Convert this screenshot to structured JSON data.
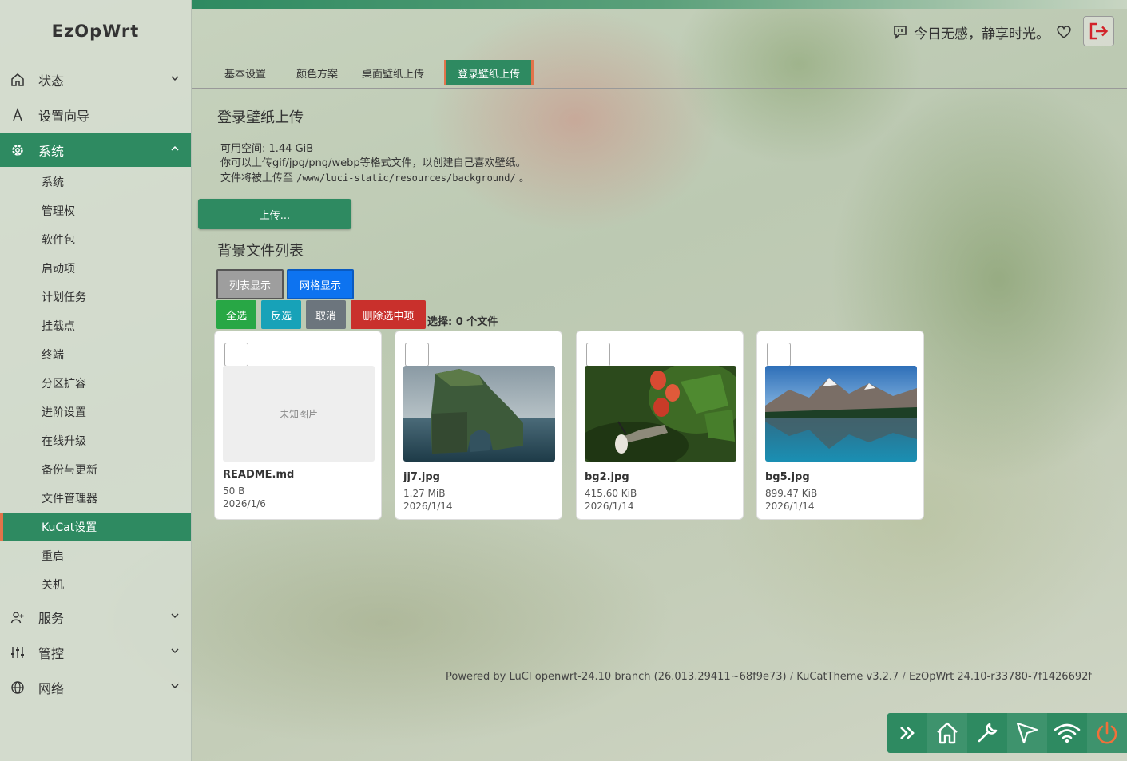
{
  "app": {
    "brand": "EzOpWrt"
  },
  "colors": {
    "accent": "#2e8a61",
    "accent_edge": "#e2734a",
    "danger": "#c9302c",
    "primary": "#0d73f0",
    "success": "#28a745",
    "info": "#17a2b8",
    "secondary": "#6c757d"
  },
  "sidebar": {
    "items": [
      {
        "label": "状态",
        "icon": "home-icon"
      },
      {
        "label": "设置向导",
        "icon": "wizard-icon"
      },
      {
        "label": "系统",
        "icon": "gear-icon"
      },
      {
        "label": "服务",
        "icon": "user-plus-icon"
      },
      {
        "label": "管控",
        "icon": "sliders-icon"
      },
      {
        "label": "网络",
        "icon": "globe-icon"
      }
    ],
    "system_sub": [
      {
        "label": "系统"
      },
      {
        "label": "管理权"
      },
      {
        "label": "软件包"
      },
      {
        "label": "启动项"
      },
      {
        "label": "计划任务"
      },
      {
        "label": "挂载点"
      },
      {
        "label": "终端"
      },
      {
        "label": "分区扩容"
      },
      {
        "label": "进阶设置"
      },
      {
        "label": "在线升级"
      },
      {
        "label": "备份与更新"
      },
      {
        "label": "文件管理器"
      },
      {
        "label": "KuCat设置"
      },
      {
        "label": "重启"
      },
      {
        "label": "关机"
      }
    ]
  },
  "header": {
    "motto": "今日无感，静享时光。"
  },
  "tabs": [
    {
      "label": "基本设置"
    },
    {
      "label": "颜色方案"
    },
    {
      "label": "桌面壁纸上传"
    },
    {
      "label": "登录壁纸上传"
    }
  ],
  "upload": {
    "title": "登录壁纸上传",
    "free_space": "可用空间: 1.44 GiB",
    "hint": "你可以上传gif/jpg/png/webp等格式文件，以创建自己喜欢壁纸。",
    "path_prefix": "文件将被上传至",
    "path": "/www/luci-static/resources/background/",
    "path_suffix": "。",
    "button": "上传..."
  },
  "files": {
    "title": "背景文件列表",
    "view_list": "列表显示",
    "view_grid": "网格显示",
    "select_all": "全选",
    "invert": "反选",
    "cancel": "取消",
    "delete_selected": "删除选中项",
    "selected_count": "选择: 0 个文件",
    "unknown_image": "未知图片",
    "items": [
      {
        "name": "README.md",
        "size": "50 B",
        "date": "2026/1/6"
      },
      {
        "name": "jj7.jpg",
        "size": "1.27 MiB",
        "date": "2026/1/14"
      },
      {
        "name": "bg2.jpg",
        "size": "415.60 KiB",
        "date": "2026/1/14"
      },
      {
        "name": "bg5.jpg",
        "size": "899.47 KiB",
        "date": "2026/1/14"
      }
    ]
  },
  "footer": {
    "powered": "Powered by LuCI openwrt-24.10 branch (26.013.29411~68f9e73)",
    "sep": "/",
    "theme": "KuCatTheme v3.2.7",
    "firmware": "EzOpWrt 24.10-r33780-7f1426692f"
  }
}
